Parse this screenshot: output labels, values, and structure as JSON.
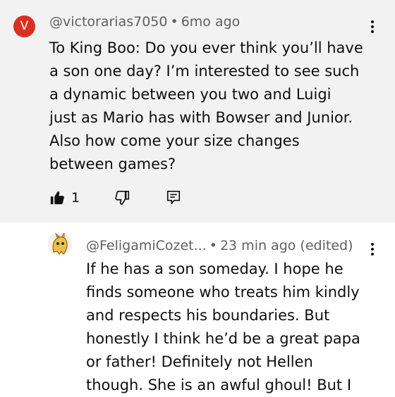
{
  "comment": {
    "avatar_letter": "V",
    "avatar_color": "#d93022",
    "author": "@victorarias7050",
    "separator": "•",
    "time": "6mo ago",
    "lines": [
      "To King Boo: Do you ever think you’ll have",
      "a son one day? I’m interested to see such",
      "a dynamic between you two and Luigi",
      "just as Mario has with Bowser and Junior.",
      "Also how come your size changes",
      "between games?"
    ],
    "like_count": "1",
    "background": "#f2f2f2"
  },
  "reply": {
    "author": "@FeligamiCozet...",
    "separator": "•",
    "time": "23 min ago (edited)",
    "lines": [
      "If he has a son someday. I hope he",
      "finds someone who treats him kindly",
      "and respects his boundaries. But",
      "honestly I think he’d be a great papa",
      "or father! Definitely not Hellen",
      "though. She is an awful ghoul! But I"
    ]
  },
  "icons": {
    "more": "more-vert-icon",
    "like": "thumbs-up-filled-icon",
    "dislike": "thumbs-down-icon",
    "reply": "reply-comment-icon"
  }
}
